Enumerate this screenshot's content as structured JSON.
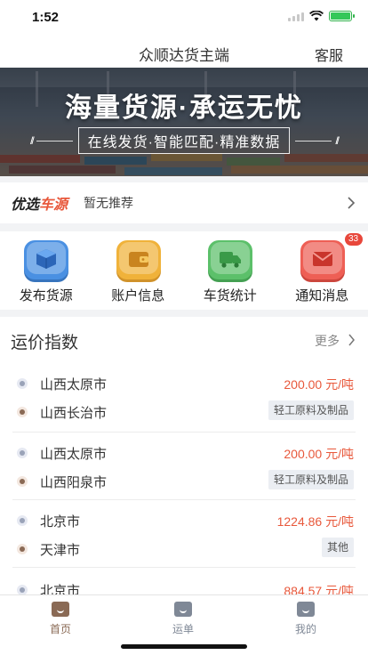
{
  "status_bar": {
    "time": "1:52"
  },
  "header": {
    "title": "众顺达货主端",
    "service_label": "客服"
  },
  "banner": {
    "title": "海量货源·承运无忧",
    "subtitle": "在线发货·智能匹配·精准数据"
  },
  "recommend": {
    "brand_prefix": "优选",
    "brand_highlight": "车源",
    "text": "暂无推荐"
  },
  "quick_actions": [
    {
      "label": "发布货源",
      "icon": "box-icon",
      "color": "#4a90e2"
    },
    {
      "label": "账户信息",
      "icon": "wallet-icon",
      "color": "#f0b23a"
    },
    {
      "label": "车货统计",
      "icon": "truck-icon",
      "color": "#5cc06a"
    },
    {
      "label": "通知消息",
      "icon": "mail-icon",
      "color": "#ee5f55",
      "badge": "33"
    }
  ],
  "price_index": {
    "title": "运价指数",
    "more_label": "更多",
    "routes": [
      {
        "from": "山西太原市",
        "to": "山西长治市",
        "price": "200.00",
        "unit": "元/吨",
        "category": "轻工原料及制品"
      },
      {
        "from": "山西太原市",
        "to": "山西阳泉市",
        "price": "200.00",
        "unit": "元/吨",
        "category": "轻工原料及制品"
      },
      {
        "from": "北京市",
        "to": "天津市",
        "price": "1224.86",
        "unit": "元/吨",
        "category": "其他"
      },
      {
        "from": "北京市",
        "to": "",
        "price": "884.57",
        "unit": "元/吨",
        "category": ""
      }
    ]
  },
  "tabbar": {
    "items": [
      {
        "label": "首页",
        "active": true
      },
      {
        "label": "运单",
        "active": false
      },
      {
        "label": "我的",
        "active": false
      }
    ],
    "active_color": "#8a6a55",
    "inactive_color": "#7f8896"
  }
}
